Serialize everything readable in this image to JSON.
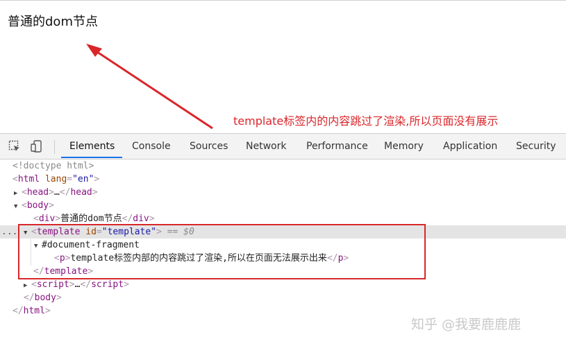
{
  "page": {
    "text": "普通的dom节点"
  },
  "annotation": {
    "text": "template标签内的内容跳过了渲染,所以页面没有展示",
    "color": "#d9262a"
  },
  "devtools": {
    "tabs": [
      "Elements",
      "Console",
      "Sources",
      "Network",
      "Performance",
      "Memory",
      "Application",
      "Security"
    ],
    "active_tab": "Elements",
    "tree": {
      "doctype": "<!doctype html>",
      "html_tag": "html",
      "lang_attr": "lang",
      "lang_val": "\"en\"",
      "head_tag": "head",
      "ellipsis": "…",
      "body_tag": "body",
      "div_tag": "div",
      "div_text": "普通的dom节点",
      "template_tag": "template",
      "id_attr": "id",
      "id_val": "\"template\"",
      "selected_marker": " == $0",
      "fragment": "#document-fragment",
      "p_tag": "p",
      "p_text": "template标签内部的内容跳过了渲染,所以在页面无法展示出来",
      "script_tag": "script",
      "dots": "..."
    }
  },
  "watermark": {
    "text": "知乎 @我要鹿鹿鹿"
  },
  "colors": {
    "tag": "#881280",
    "attr": "#994500",
    "value": "#1a1aa6",
    "highlight_box": "#d9262a",
    "tab_accent": "#1a73e8"
  },
  "icons": [
    "inspect-element-icon",
    "device-toolbar-icon",
    "red-arrow-icon"
  ]
}
